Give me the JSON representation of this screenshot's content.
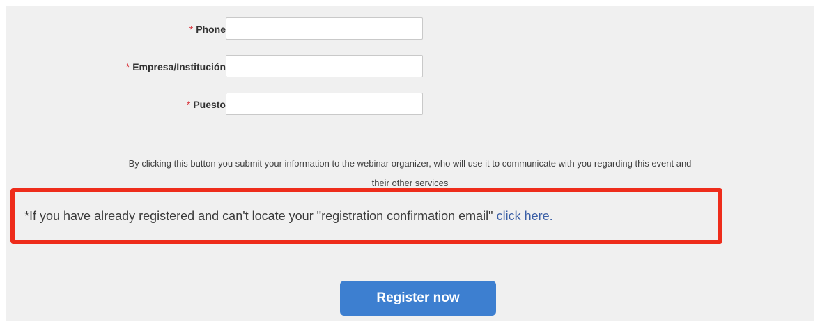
{
  "form": {
    "fields": [
      {
        "required_mark": "*",
        "label": "Phone",
        "value": "",
        "placeholder": ""
      },
      {
        "required_mark": "*",
        "label": "Empresa/Institución",
        "value": "",
        "placeholder": ""
      },
      {
        "required_mark": "*",
        "label": "Puesto",
        "value": "",
        "placeholder": ""
      }
    ]
  },
  "disclaimer": {
    "line1": "By clicking this button you submit your information to the webinar organizer, who will use it to communicate with you regarding this event and",
    "line2": "their other services"
  },
  "already_registered": {
    "text": "*If you have already registered and can't locate your \"registration confirmation email\" ",
    "link_text": "click here."
  },
  "actions": {
    "register_label": "Register now"
  },
  "colors": {
    "accent": "#3d7fd0",
    "highlight_border": "#ee2c1b",
    "link": "#3b5fa6",
    "required": "#d9363e"
  }
}
